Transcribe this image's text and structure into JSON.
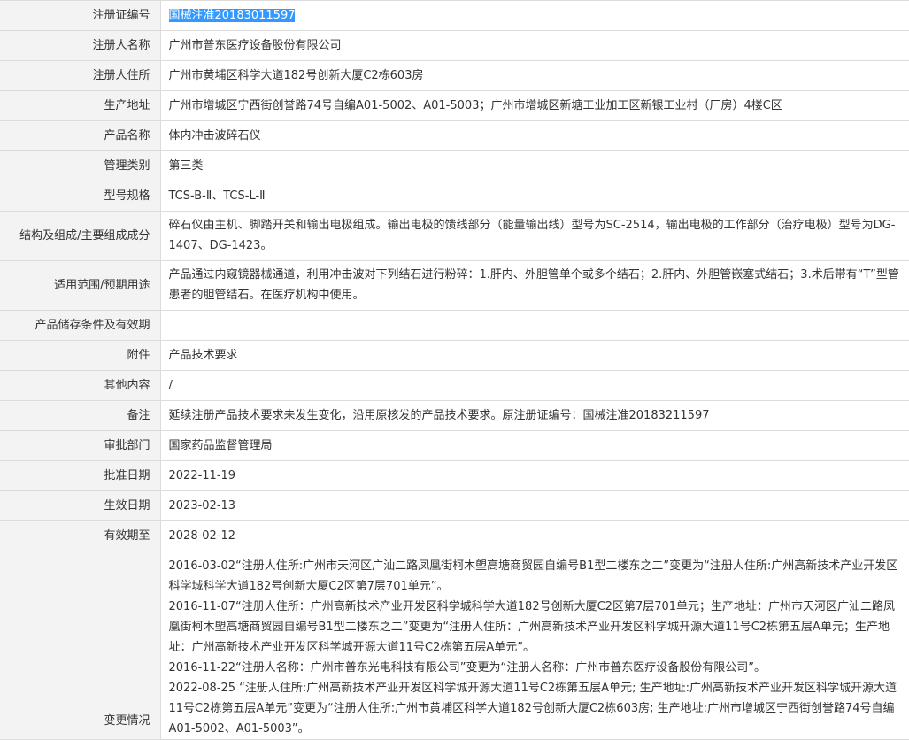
{
  "rows": [
    {
      "label": "注册证编号",
      "value": "国械注准20183011597"
    },
    {
      "label": "注册人名称",
      "value": "广州市普东医疗设备股份有限公司"
    },
    {
      "label": "注册人住所",
      "value": "广州市黄埔区科学大道182号创新大厦C2栋603房"
    },
    {
      "label": "生产地址",
      "value": "广州市增城区宁西街创誉路74号自编A01-5002、A01-5003；广州市增城区新塘工业加工区新银工业村（厂房）4楼C区"
    },
    {
      "label": "产品名称",
      "value": "体内冲击波碎石仪"
    },
    {
      "label": "管理类别",
      "value": "第三类"
    },
    {
      "label": "型号规格",
      "value": "TCS-B-Ⅱ、TCS-L-Ⅱ"
    },
    {
      "label": "结构及组成/主要组成成分",
      "value": "碎石仪由主机、脚踏开关和输出电极组成。输出电极的馈线部分（能量输出线）型号为SC-2514，输出电极的工作部分（治疗电极）型号为DG-1407、DG-1423。"
    },
    {
      "label": "适用范围/预期用途",
      "value": "产品通过内窥镜器械通道，利用冲击波对下列结石进行粉碎：1.肝内、外胆管单个或多个结石；2.肝内、外胆管嵌塞式结石；3.术后带有“T”型管患者的胆管结石。在医疗机构中使用。"
    },
    {
      "label": "产品储存条件及有效期",
      "value": ""
    },
    {
      "label": "附件",
      "value": "产品技术要求"
    },
    {
      "label": "其他内容",
      "value": "/"
    },
    {
      "label": "备注",
      "value": "延续注册产品技术要求未发生变化，沿用原核发的产品技术要求。原注册证编号：国械注准20183211597"
    },
    {
      "label": "审批部门",
      "value": "国家药品监督管理局"
    },
    {
      "label": "批准日期",
      "value": "2022-11-19"
    },
    {
      "label": "生效日期",
      "value": "2023-02-13"
    },
    {
      "label": "有效期至",
      "value": "2028-02-12"
    }
  ],
  "changes": {
    "label": "变更情况",
    "entries": [
      "2016-03-02“注册人住所:广州市天河区广汕二路凤凰街柯木塱高塘商贸园自编号B1型二楼东之二”变更为“注册人住所:广州高新技术产业开发区科学城科学大道182号创新大厦C2区第7层701单元”。",
      "2016-11-07“注册人住所：广州高新技术产业开发区科学城科学大道182号创新大厦C2区第7层701单元；生产地址：广州市天河区广汕二路凤凰街柯木塱高塘商贸园自编号B1型二楼东之二”变更为“注册人住所：广州高新技术产业开发区科学城开源大道11号C2栋第五层A单元；生产地址：广州高新技术产业开发区科学城开源大道11号C2栋第五层A单元”。",
      "2016-11-22“注册人名称：广州市普东光电科技有限公司”变更为“注册人名称：广州市普东医疗设备股份有限公司”。",
      "2022-08-25 “注册人住所:广州高新技术产业开发区科学城开源大道11号C2栋第五层A单元; 生产地址:广州高新技术产业开发区科学城开源大道11号C2栋第五层A单元”变更为“注册人住所:广州市黄埔区科学大道182号创新大厦C2栋603房; 生产地址:广州市增城区宁西街创誉路74号自编A01-5002、A01-5003”。"
    ]
  }
}
